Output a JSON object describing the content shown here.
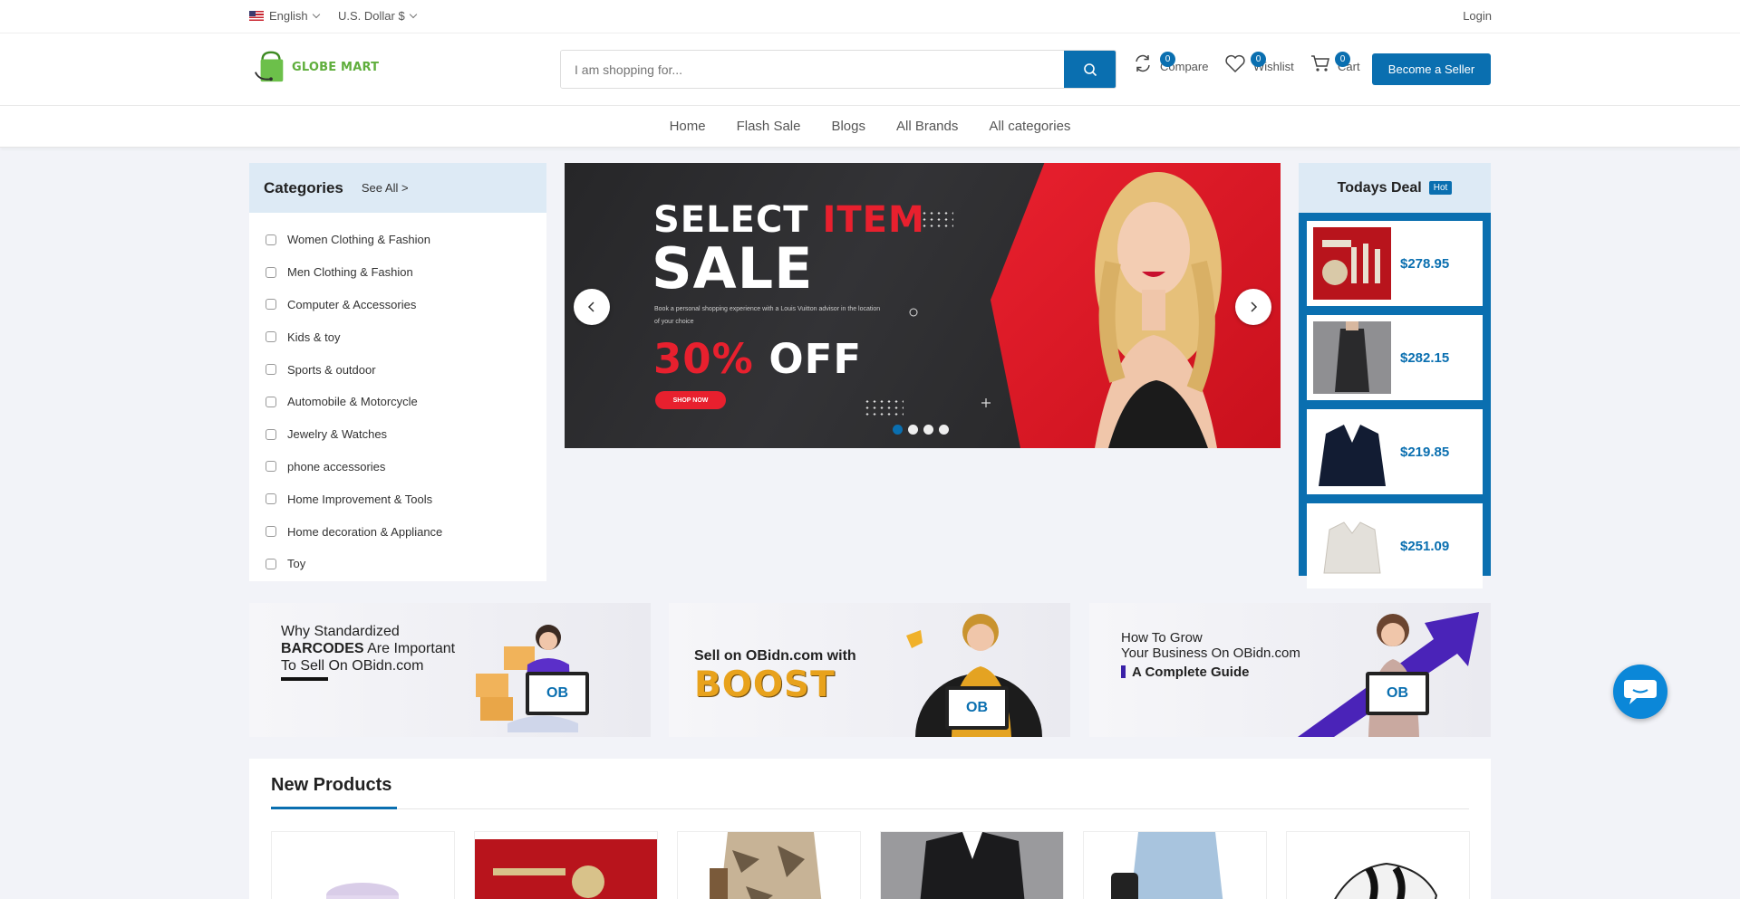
{
  "topbar": {
    "language": "English",
    "currency": "U.S. Dollar $",
    "login": "Login"
  },
  "header": {
    "logo_text": "GLOBE MART",
    "search_placeholder": "I am shopping for...",
    "compare": {
      "label": "Compare",
      "count": "0"
    },
    "wishlist": {
      "label": "Wishlist",
      "count": "0"
    },
    "cart": {
      "label": "Cart",
      "count": "0"
    },
    "become_seller": "Become a Seller"
  },
  "nav": [
    "Home",
    "Flash Sale",
    "Blogs",
    "All Brands",
    "All categories"
  ],
  "categories": {
    "title": "Categories",
    "see_all": "See All >",
    "items": [
      "Women Clothing & Fashion",
      "Men Clothing & Fashion",
      "Computer & Accessories",
      "Kids & toy",
      "Sports & outdoor",
      "Automobile & Motorcycle",
      "Jewelry & Watches",
      "phone accessories",
      "Home Improvement & Tools",
      "Home decoration & Appliance",
      "Toy"
    ]
  },
  "slider": {
    "line1_white": "SELECT ",
    "line1_red": "ITEM",
    "line2": "SALE",
    "desc": "Book a personal shopping experience with a Louis Vuitton advisor in the location of your choice",
    "off_red": "30%",
    "off_white": " OFF",
    "shop_now": "SHOP NOW",
    "active_slide": 1,
    "slide_count": 4
  },
  "todays_deal": {
    "title": "Todays Deal",
    "badge": "Hot",
    "items": [
      {
        "price": "$278.95"
      },
      {
        "price": "$282.15"
      },
      {
        "price": "$219.85"
      },
      {
        "price": "$251.09"
      }
    ]
  },
  "banners": {
    "b1": {
      "line1": "Why Standardized",
      "bold": "BARCODES",
      "line2_rest": " Are Important",
      "line3": "To Sell On OBidn.com",
      "logo": "OB"
    },
    "b2": {
      "line1": "Sell on OBidn.com with",
      "boost": "BOOST",
      "logo": "OB"
    },
    "b3": {
      "line1": "How To Grow",
      "line2": "Your Business On OBidn.com",
      "guide": "A Complete Guide",
      "logo": "OB"
    }
  },
  "new_products": {
    "title": "New Products"
  },
  "colors": {
    "primary": "#0a6fb0",
    "accent_red": "#e8202e",
    "logo_green": "#5fae3c"
  }
}
